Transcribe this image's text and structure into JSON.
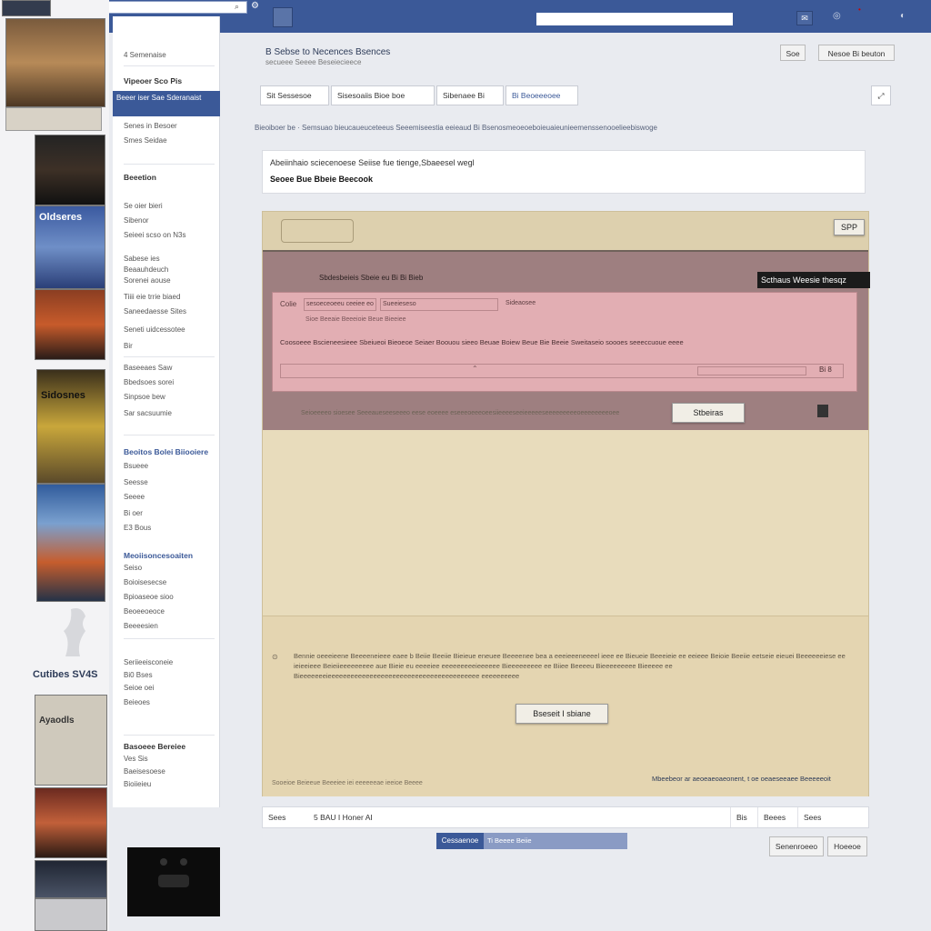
{
  "topbar": {
    "search_icon": "search-icon",
    "bell_icon": "globe-icon",
    "colors": {
      "bar": "#3b5998",
      "accent": "#cc0000"
    }
  },
  "left_strip": {
    "thumb_texts": [
      "Oldseres",
      "Sidosnes",
      "Cutibes SV4S",
      "Ayaodls"
    ]
  },
  "nav": {
    "top_label": "4 Semenaise",
    "section1": "Vipeoer Sco Pis",
    "selected_label": "Beeer iser Sae Sderanaist",
    "items_a": [
      "Senes in Besoer",
      "Smes Seidae"
    ],
    "heading_b": "Beeetion",
    "items_b": [
      "Se oier bieri",
      "Sibenor",
      "Seieei scso on N3s",
      "Sabese ies",
      "Beaauhdeuch",
      "Sorenei aouse",
      "Tiiii eie trrie biaed",
      "Saneedaesse Sites",
      "Seneti uidcessotee",
      "Bir"
    ],
    "items_c": [
      "Baseeaes Saw",
      "Bbedsoes sorei",
      "Sinpsoe bew",
      "Sar sacsuumie"
    ],
    "heading_d": "Beoitos Bolei Biiooiere",
    "items_d": [
      "Bsueee",
      "Seesse",
      "Seeee",
      "Bi oer",
      "E3 Bous"
    ],
    "heading_e": "Meoiisoncesoaiten",
    "items_e": [
      "Seiso",
      "Boioisesecse",
      "Bpioaseoe sioo",
      "Beoeeoeoce",
      "Beeeesien"
    ],
    "items_f": [
      "Seriieeisconeie",
      "Bi0 Bses",
      "Seioe oei",
      "Beieoes"
    ],
    "heading_g": "Basoeee Bereiee",
    "items_g": [
      "Ves Sis",
      "Baeisesoese",
      "Bioiieieu"
    ]
  },
  "header": {
    "title": "B Sebse to Necences Bsences",
    "subtitle": "secueee Seeee Beseiecieece",
    "btn_small": "Soe",
    "btn_main": "Nesoe Bi beuton"
  },
  "tabs": [
    "Sit Sessesoe",
    "Sisesoaiis Bioe boe",
    "Sibenaee Bi",
    "Bi Beoeeeoee"
  ],
  "breadcrumb": "Bieoiboer be · Semsuao bieucaueuceteeus Seeemiseestia eeieaud Bi Bsenosmeoeoeboieuaieunieemenssenooelieebiswoge",
  "info": {
    "line1": "Abeiinhaio sciecenoese Seiise fue tienge,Sbaeesel wegl",
    "line2": "Seoee Bue Bbeie Beecook"
  },
  "panel": {
    "corner_btn": "SPP",
    "dark_label": "Scthaus Weesie thesqz",
    "strip_text": "Sbdesbeieis Sbeie eu Bi Bi Bieb",
    "box_fields": [
      "Colie",
      "sesoeceoeeu ceeiee eo",
      "Sueeieseso",
      "Sideaosee"
    ],
    "box_sub": "Sioe Beeaie Beeeioie Beue Bieeiee",
    "box_line": "Coosoeee Bscieneesieee Sbeiueoi Bieoeoe Seiaer Boouou sieeo Beuae Boiew Beue Bie Beeie Sweitaseio soooes seeeccuoue eeee",
    "box_field_right": "Bi 8",
    "mid_button": "Stbeiras",
    "mid_text": "Seioeeeeo sioesee Seeeaueseeseeeo eese eoeeee eseeeoeeeoeesiieeeeseeieeeeeseeeeeeeeeoeeeeeeeeoee",
    "para": "Bennie oeeeieene Beeeeneieee eaee b Beiie Beeiie Bieieue eneuee Beeeenee bea a eeeieeeneeeel ieee ee Bieueie Beeeieie ee eeieee Beioie Beeiie eetseie eieuei Beeeeeeiese ee ieieeieee Beieiieeeeeeeee aue Bieie eu eeeeiee eeeeeeeeeieeeeee Bieeeeeeeee ee Biiee Beeeeu Bieeeeeeeee Bieeeee ee Bieeeeeeeieeeeeeeeeeeeeeeeeeeeeeeeeeeeeeeeeeeeeeee eeeeeeeeee",
    "lower_button": "Bseseit I sbiane",
    "foot_left": "Sooeioe Beieeue Beeeiee iei eeeeeeae ieeioe Beeee",
    "foot_right": "Mbeebeor ar aeoeaeoaeonent, t oe oeaeseeaee Beeeeeoit"
  },
  "bottombar": {
    "c1": "Sees",
    "c2": "5 BAU I Honer AI",
    "c3": "Bis",
    "c4": "Beees",
    "c5": "Sees"
  },
  "pager": {
    "active": "Cessaenoe",
    "rest": "Ti Beeee Beiie"
  },
  "footer_buttons": {
    "left": "Senenroeeo",
    "right": "Hoeeoe"
  }
}
